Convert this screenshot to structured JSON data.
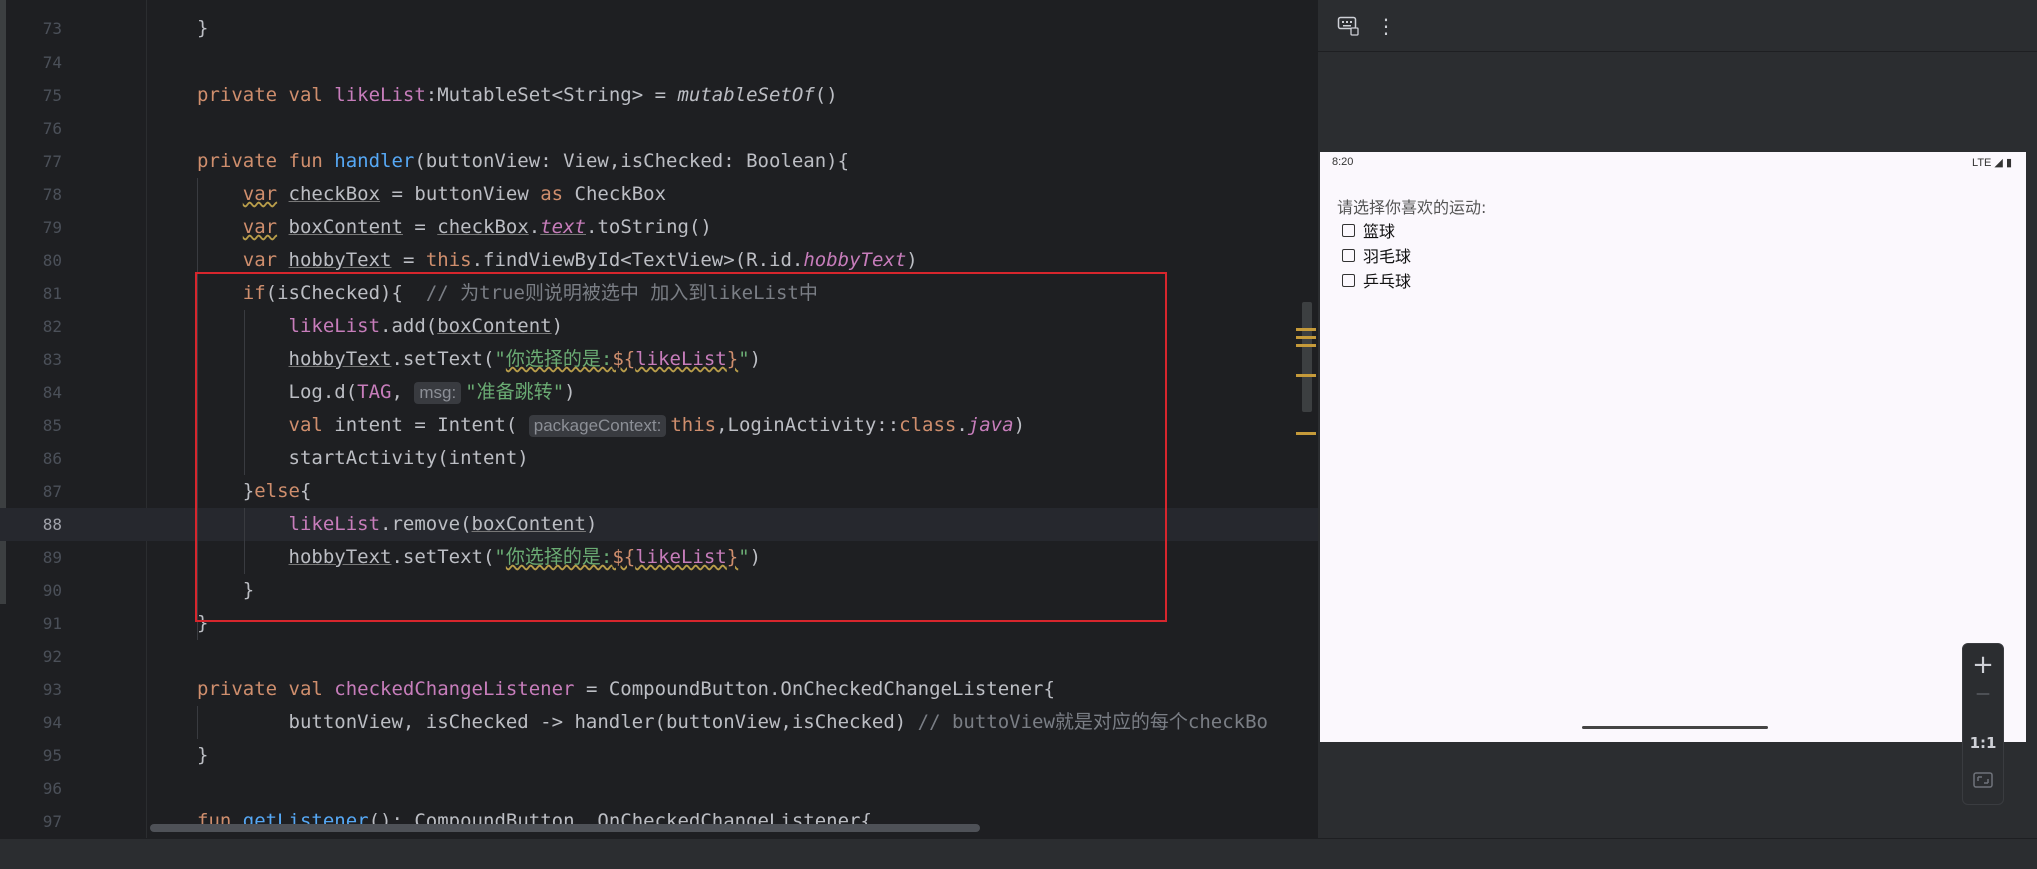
{
  "editor": {
    "lines": [
      {
        "n": "74"
      },
      {
        "n": "75"
      },
      {
        "n": "76"
      },
      {
        "n": "77"
      },
      {
        "n": "78"
      },
      {
        "n": "79"
      },
      {
        "n": "80"
      },
      {
        "n": "81"
      },
      {
        "n": "82"
      },
      {
        "n": "83"
      },
      {
        "n": "84"
      },
      {
        "n": "85"
      },
      {
        "n": "86"
      },
      {
        "n": "87"
      },
      {
        "n": "88"
      },
      {
        "n": "89"
      },
      {
        "n": "90"
      },
      {
        "n": "91"
      },
      {
        "n": "92"
      },
      {
        "n": "93"
      },
      {
        "n": "94"
      },
      {
        "n": "95"
      },
      {
        "n": "96"
      },
      {
        "n": "97"
      }
    ],
    "top_line": {
      "n": "73",
      "text": "}"
    },
    "hints": {
      "msg": "msg:",
      "package_context": "packageContext:"
    },
    "comments": {
      "l81": "// 为true则说明被选中 加入到likeList中",
      "l94": "// buttoView就是对应的每个checkBo"
    },
    "strings": {
      "selected_prefix": "你选择的是:",
      "jump": "准备跳转"
    },
    "current_line": "88"
  },
  "emulator": {
    "toolbar_icons": [
      "keyboard-icon",
      "more-vert-icon"
    ],
    "more_label": "⋮",
    "status_time": "8:20",
    "status_net": "LTE ◢ ▮",
    "prompt": "请选择你喜欢的运动:",
    "options": [
      "篮球",
      "羽毛球",
      "乒乓球"
    ],
    "zoom_in": "+",
    "zoom_out": "—",
    "zoom_reset": "1:1"
  }
}
